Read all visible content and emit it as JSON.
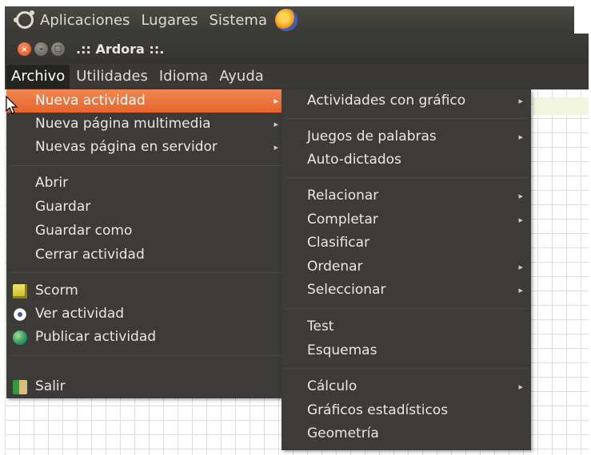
{
  "topbar": {
    "items": [
      "Aplicaciones",
      "Lugares",
      "Sistema"
    ]
  },
  "window": {
    "title": ".:: Ardora ::.",
    "buttons": {
      "close": "×",
      "minimize": "–",
      "maximize": "□"
    }
  },
  "menubar": {
    "items": [
      "Archivo",
      "Utilidades",
      "Idioma",
      "Ayuda"
    ],
    "active": "Archivo"
  },
  "archivo_menu": {
    "items": [
      {
        "label": "Nueva actividad",
        "submenu": true,
        "highlight": true
      },
      {
        "label": "Nueva página multimedia",
        "submenu": true
      },
      {
        "label": "Nuevas página en servidor",
        "submenu": true
      },
      {
        "label": "Abrir"
      },
      {
        "label": "Guardar"
      },
      {
        "label": "Guardar como"
      },
      {
        "label": "Cerrar actividad"
      },
      {
        "label": "Scorm",
        "icon": "scorm-icon"
      },
      {
        "label": "Ver actividad",
        "icon": "eye-icon"
      },
      {
        "label": "Publicar actividad",
        "icon": "globe-icon"
      },
      {
        "label": "Salir",
        "icon": "exit-icon"
      }
    ]
  },
  "nueva_actividad_submenu": {
    "items": [
      {
        "label": "Actividades con gráfico",
        "submenu": true
      },
      {
        "label": "Juegos de palabras",
        "submenu": true
      },
      {
        "label": "Auto-dictados"
      },
      {
        "label": "Relacionar",
        "submenu": true
      },
      {
        "label": "Completar",
        "submenu": true
      },
      {
        "label": "Clasificar"
      },
      {
        "label": "Ordenar",
        "submenu": true
      },
      {
        "label": "Seleccionar",
        "submenu": true
      },
      {
        "label": "Test"
      },
      {
        "label": "Esquemas"
      },
      {
        "label": "Cálculo",
        "submenu": true
      },
      {
        "label": "Gráficos estadísticos"
      },
      {
        "label": "Geometría"
      }
    ]
  },
  "colors": {
    "highlight": "#e7642b",
    "menu_bg": "#3c3b37",
    "panel_bg": "#3a3935"
  }
}
